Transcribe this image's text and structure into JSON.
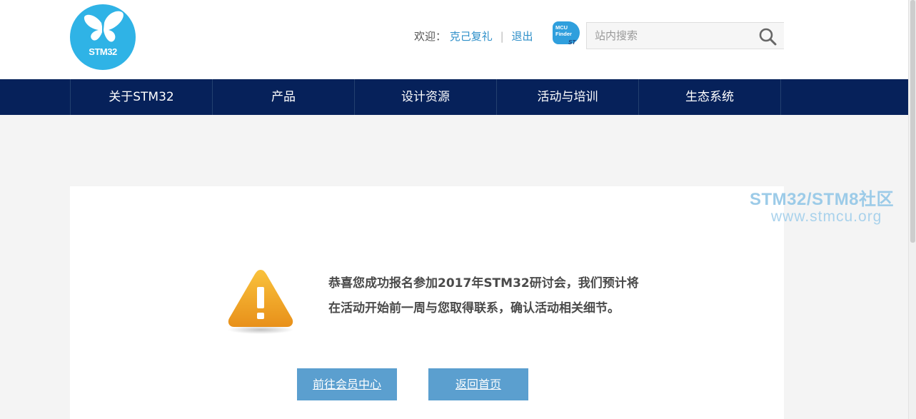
{
  "header": {
    "logo_text": "STM32",
    "welcome_label": "欢迎：",
    "username": "克己复礼",
    "separator": "|",
    "logout": "退出",
    "mcu_finder_line1": "MCU",
    "mcu_finder_line2": "Finder",
    "mcu_finder_brand": "ST",
    "search_placeholder": "站内搜索"
  },
  "nav": {
    "items": [
      {
        "label": "关于STM32"
      },
      {
        "label": "产品"
      },
      {
        "label": "设计资源"
      },
      {
        "label": "活动与培训"
      },
      {
        "label": "生态系统"
      }
    ]
  },
  "watermark": {
    "line1": "STM32/STM8社区",
    "line2": "www.stmcu.org"
  },
  "main": {
    "message_line1": "恭喜您成功报名参加2017年STM32研讨会，我们预计将",
    "message_line2": "在活动开始前一周与您取得联系，确认活动相关细节。",
    "btn_member_center": "前往会员中心",
    "btn_home": "返回首页"
  },
  "colors": {
    "nav_bg": "#06215a",
    "logo_bg": "#2fb3e6",
    "button_bg": "#5b9fcf",
    "link": "#2e8fc9",
    "warning": "#f2a01c"
  },
  "icons": {
    "logo": "butterfly-logo",
    "search": "search-icon",
    "warning": "warning-triangle-icon"
  }
}
